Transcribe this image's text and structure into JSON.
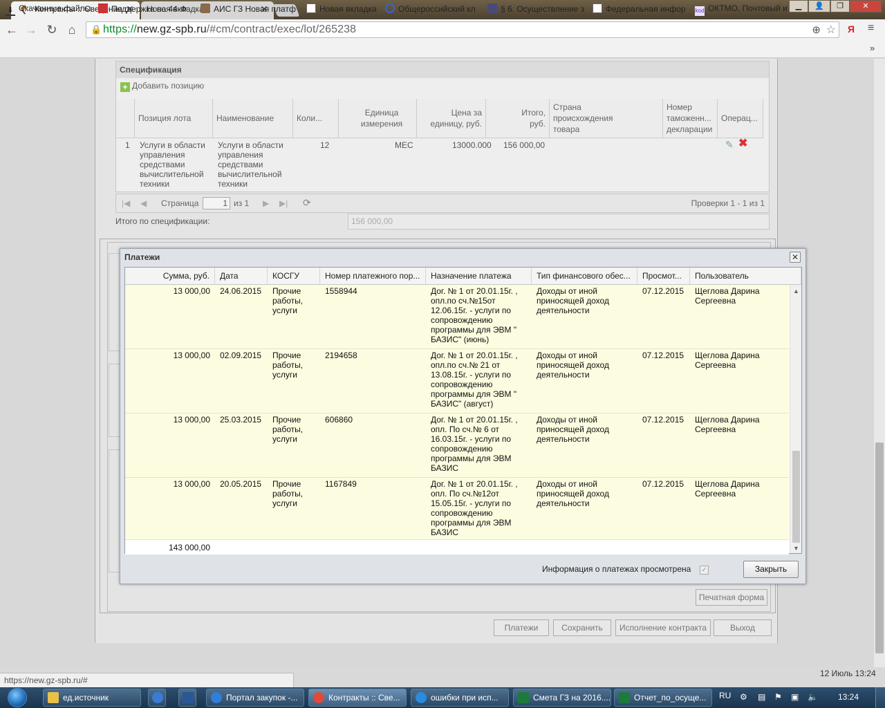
{
  "browser": {
    "tabs": [
      {
        "label": "Контракты :: Сведения о",
        "active": true
      },
      {
        "label": "Новая вкладка",
        "active": false
      }
    ],
    "url_scheme": "https://",
    "url_host": "new.gz-spb.ru",
    "url_path": "/#cm/contract/exec/lot/265238",
    "bookmarks": [
      {
        "label": "Скачанные файлы",
        "icon": "download-icon"
      },
      {
        "label": "Поддержка по 44-Ф",
        "icon": "site-icon"
      },
      {
        "label": "АИС ГЗ Новая платф",
        "icon": "gavel-icon"
      },
      {
        "label": "Новая вкладка",
        "icon": "page-icon"
      },
      {
        "label": "Общероссийский кл",
        "icon": "site-icon"
      },
      {
        "label": "§ 6. Осуществление з",
        "icon": "site-icon"
      },
      {
        "label": "Федеральная инфор",
        "icon": "page-icon"
      },
      {
        "label": "ОКТМО, Почтовый и",
        "icon": "kod-icon"
      }
    ]
  },
  "spec": {
    "title": "Спецификация",
    "add_label": "Добавить позицию",
    "columns": [
      "Позиция лота",
      "Наименование",
      "Коли...",
      "Единица измерения",
      "Цена за единицу, руб.",
      "Итого, руб.",
      "Страна происхождения товара",
      "Номер таможенн... декларации",
      "Операц..."
    ],
    "row": {
      "num": "1",
      "position": "Услуги в области управления средствами вычислительной техники",
      "name": "Услуги в области управления средствами вычислительной техники",
      "qty": "12",
      "unit": "МЕС",
      "price": "13000.000",
      "total": "156 000,00"
    },
    "pager": {
      "page_label": "Страница",
      "page": "1",
      "of": "из 1",
      "summary": "Проверки 1 - 1 из 1"
    },
    "total_label": "Итого по спецификации:",
    "total_value": "156 000,00"
  },
  "page_buttons": {
    "print": "Печатная форма",
    "payments": "Платежи",
    "save": "Сохранить",
    "execution": "Исполнение контракта",
    "exit": "Выход"
  },
  "modal": {
    "title": "Платежи",
    "columns": [
      "Сумма, руб.",
      "Дата",
      "КОСГУ",
      "Номер платежного пор...",
      "Назначение платежа",
      "Тип финансового обес...",
      "Просмот...",
      "Пользователь"
    ],
    "rows": [
      {
        "sum": "13 000,00",
        "date": "24.06.2015",
        "kosgu": "Прочие работы, услуги",
        "number": "1558944",
        "purpose": "Дог. № 1 от 20.01.15г. , опл.по сч.№15от 12.06.15г. - услуги по сопровождению программы для ЭВМ \" БАЗИС\" (июнь)",
        "fin_type": "Доходы от иной приносящей доход деятельности",
        "viewed": "07.12.2015",
        "user": "Щеглова Дарина Сергеевна"
      },
      {
        "sum": "13 000,00",
        "date": "02.09.2015",
        "kosgu": "Прочие работы, услуги",
        "number": "2194658",
        "purpose": "Дог. № 1 от 20.01.15г. , опл.по сч.№ 21 от 13.08.15г. - услуги по сопровождению программы для ЭВМ \" БАЗИС\" (август)",
        "fin_type": "Доходы от иной приносящей доход деятельности",
        "viewed": "07.12.2015",
        "user": "Щеглова Дарина Сергеевна"
      },
      {
        "sum": "13 000,00",
        "date": "25.03.2015",
        "kosgu": "Прочие работы, услуги",
        "number": "606860",
        "purpose": "Дог. № 1 от 20.01.15г. , опл. По сч.№ 6 от 16.03.15г. - услуги по сопровождению программы для ЭВМ БАЗИС",
        "fin_type": "Доходы от иной приносящей доход деятельности",
        "viewed": "07.12.2015",
        "user": "Щеглова Дарина Сергеевна"
      },
      {
        "sum": "13 000,00",
        "date": "20.05.2015",
        "kosgu": "Прочие работы, услуги",
        "number": "1167849",
        "purpose": "Дог. № 1 от 20.01.15г. , опл. По сч.№12от 15.05.15г. - услуги по сопровождению программы для ЭВМ БАЗИС",
        "fin_type": "Доходы от иной приносящей доход деятельности",
        "viewed": "07.12.2015",
        "user": "Щеглова Дарина Сергеевна"
      }
    ],
    "sum_total": "143 000,00",
    "viewed_label": "Информация о платежах просмотрена",
    "close_label": "Закрыть"
  },
  "status": {
    "hover_url": "https://new.gz-spb.ru/#",
    "page_datetime": "12 Июль 13:24"
  },
  "taskbar": {
    "items": [
      {
        "label": "ед.источник",
        "color": "#e8c04a"
      },
      {
        "label": "",
        "color": "#3a7bd5"
      },
      {
        "label": "",
        "color": "#2b5797"
      },
      {
        "label": "Портал закупок -...",
        "color": "#2f7fd6"
      },
      {
        "label": "Контракты :: Све...",
        "color": "#e04a3a"
      },
      {
        "label": "ошибки при исп...",
        "color": "#2b8cdf"
      },
      {
        "label": "Смета ГЗ на 2016....",
        "color": "#1e7a3c"
      },
      {
        "label": "Отчет_по_осуще...",
        "color": "#1e7a3c"
      }
    ],
    "lang": "RU",
    "clock": "13:24"
  }
}
